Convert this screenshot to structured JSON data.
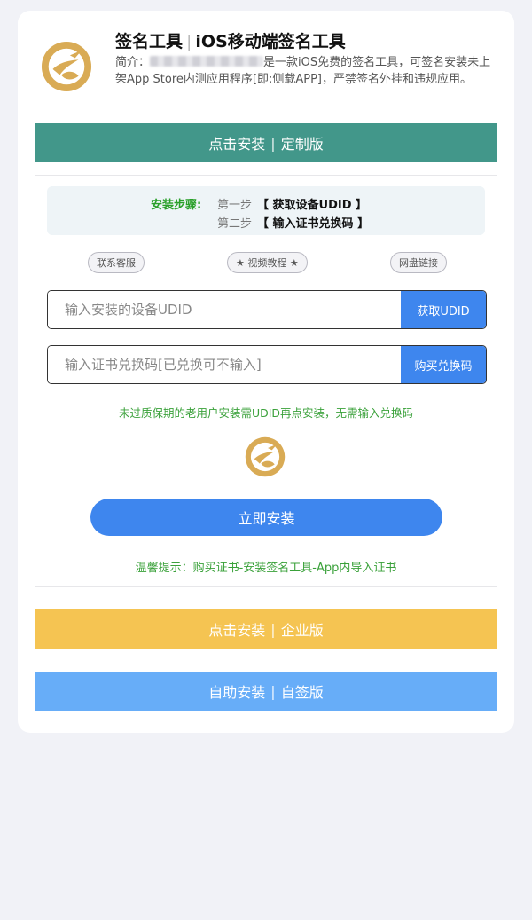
{
  "header": {
    "title_main": "签名工具",
    "title_sep": "|",
    "title_sub": "iOS移动端签名工具",
    "intro_prefix": "简介：",
    "intro_rest": "是一款iOS免费的签名工具，可签名安装未上架App Store内测应用程序[即:侧载APP]，严禁签名外挂和违规应用。"
  },
  "banners": {
    "custom": {
      "left": "点击安装",
      "sep": "|",
      "right": "定制版"
    },
    "enterprise": {
      "left": "点击安装",
      "sep": "|",
      "right": "企业版"
    },
    "self": {
      "left": "自助安装",
      "sep": "|",
      "right": "自签版"
    }
  },
  "steps": {
    "label": "安装步骤:",
    "items": [
      {
        "no": "第一步",
        "text": "【 获取设备UDID 】"
      },
      {
        "no": "第二步",
        "text": "【 输入证书兑换码 】"
      }
    ]
  },
  "links": {
    "service": "联系客服",
    "video": "★ 视频教程 ★",
    "netdisk": "网盘链接"
  },
  "udid": {
    "placeholder": "输入安装的设备UDID",
    "value": "",
    "button": "获取UDID"
  },
  "code": {
    "placeholder": "输入证书兑换码[已兑换可不输入]",
    "value": "",
    "button": "购买兑换码"
  },
  "notice": "未过质保期的老用户安装需UDID再点安装，无需输入兑换码",
  "install_button": "立即安装",
  "tip": "温馨提示：购买证书-安装签名工具-App内导入证书",
  "colors": {
    "green_banner": "#42978a",
    "yellow_banner": "#f5c452",
    "blue_banner": "#67adf8",
    "primary_button": "#3e86ee",
    "notice_text": "#3aa13a",
    "logo_gold": "#d9ab55"
  }
}
